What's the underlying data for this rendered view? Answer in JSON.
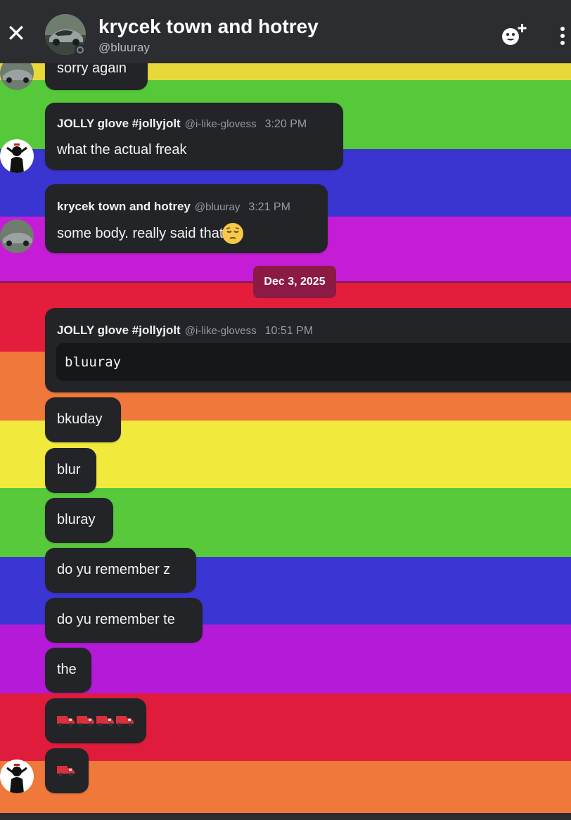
{
  "header": {
    "title": "krycek town and hotrey",
    "handle": "@bluuray",
    "close_icon": "close-icon",
    "add_icon": "add-member-icon",
    "more_icon": "more-vertical-icon"
  },
  "colors": {
    "stripes": [
      "#e8d93a",
      "#55c93a",
      "#3a34d0",
      "#c51cd6",
      "#e41d3c",
      "#f0783a",
      "#f2e93d",
      "#58c93b",
      "#3b36d3",
      "#b41ad8",
      "#e01c3c",
      "#f0783a"
    ],
    "bubble": "#232428",
    "date_pill": "#8b1a45"
  },
  "messages": {
    "m0": {
      "text": "sorry again"
    },
    "m1": {
      "author": "JOLLY glove #jollyjolt",
      "handle": "@i-like-glovess",
      "time": "3:20 PM",
      "text": "what the actual freak"
    },
    "m2": {
      "author": "krycek town and hotrey",
      "handle": "@bluuray",
      "time": "3:21 PM",
      "text": "some body. really said that",
      "emoji": "pensive-face"
    },
    "date_divider": "Dec 3, 2025",
    "m3": {
      "author": "JOLLY glove #jollyjolt",
      "handle": "@i-like-glovess",
      "time": "10:51 PM",
      "code": "bluuray"
    },
    "m4": {
      "text": "bkuday"
    },
    "m5": {
      "text": "blur"
    },
    "m6": {
      "text": "bluray"
    },
    "m7": {
      "text": "do yu remember z"
    },
    "m8": {
      "text": "do yu remember te"
    },
    "m9": {
      "text": "the"
    },
    "m10": {
      "emoji": "delivery-truck",
      "count": 4
    },
    "m11": {
      "emoji": "delivery-truck",
      "count": 1
    }
  }
}
